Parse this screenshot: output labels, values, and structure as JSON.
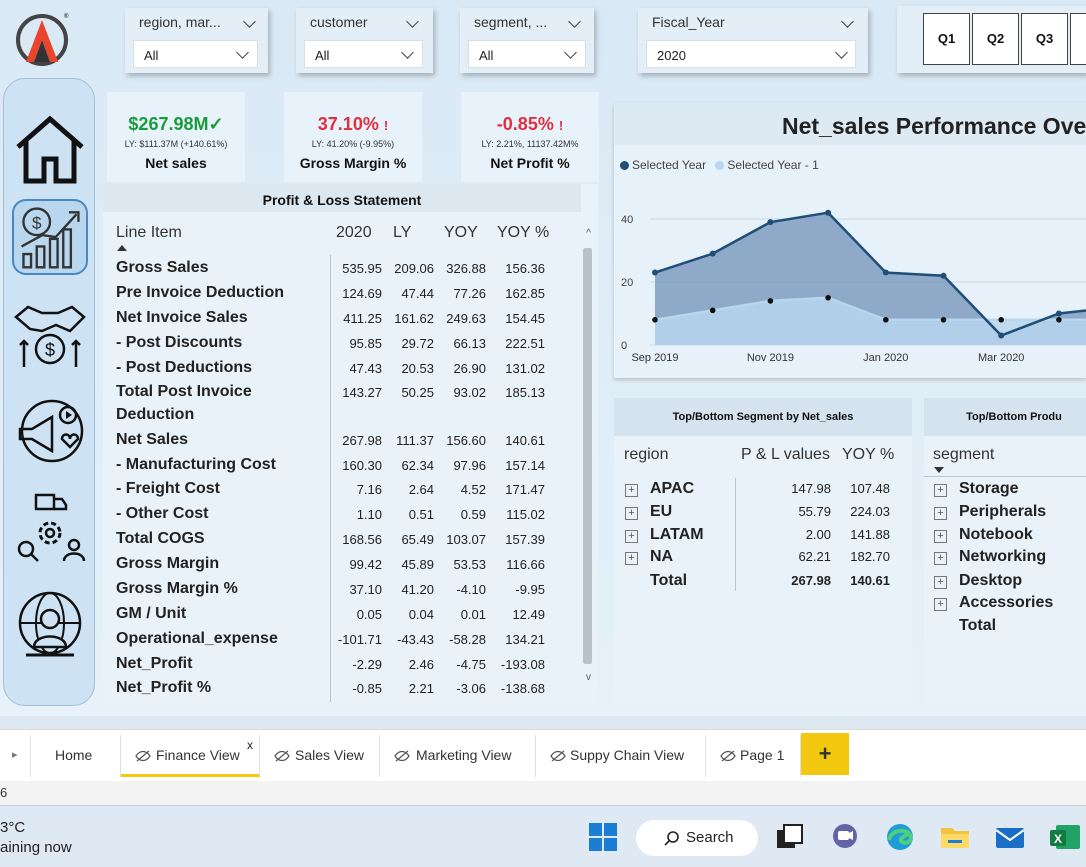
{
  "slicers": {
    "region": {
      "label": "region, mar...",
      "value": "All"
    },
    "customer": {
      "label": "customer",
      "value": "All"
    },
    "segment": {
      "label": "segment, ...",
      "value": "All"
    },
    "fiscal_year": {
      "label": "Fiscal_Year",
      "value": "2020"
    }
  },
  "quarters": [
    "Q1",
    "Q2",
    "Q3"
  ],
  "kpis": {
    "net_sales": {
      "value": "$267.98M",
      "ly": "LY: $111.37M (+140.61%)",
      "title": "Net sales",
      "color": "#1a9c3c"
    },
    "gross_margin": {
      "value": "37.10%",
      "ly": "LY: 41.20% (-9.95%)",
      "title": "Gross Margin %",
      "color": "#e03040"
    },
    "net_profit": {
      "value": "-0.85%",
      "ly": "LY: 2.21%, 11137.42M%",
      "title": "Net Profit %",
      "color": "#e03040"
    }
  },
  "pl": {
    "title": "Profit & Loss Statement",
    "headers": [
      "Line Item",
      "2020",
      "LY",
      "YOY",
      "YOY %"
    ],
    "rows": [
      {
        "label": "Gross Sales",
        "v": [
          "535.95",
          "209.06",
          "326.88",
          "156.36"
        ]
      },
      {
        "label": "Pre Invoice Deduction",
        "v": [
          "124.69",
          "47.44",
          "77.26",
          "162.85"
        ]
      },
      {
        "label": "Net Invoice Sales",
        "v": [
          "411.25",
          "161.62",
          "249.63",
          "154.45"
        ]
      },
      {
        "label": "- Post Discounts",
        "v": [
          "95.85",
          "29.72",
          "66.13",
          "222.51"
        ]
      },
      {
        "label": "- Post Deductions",
        "v": [
          "47.43",
          "20.53",
          "26.90",
          "131.02"
        ]
      },
      {
        "label": "Total Post Invoice",
        "label2": "Deduction",
        "v": [
          "143.27",
          "50.25",
          "93.02",
          "185.13"
        ]
      },
      {
        "label": "Net Sales",
        "v": [
          "267.98",
          "111.37",
          "156.60",
          "140.61"
        ]
      },
      {
        "label": "- Manufacturing Cost",
        "v": [
          "160.30",
          "62.34",
          "97.96",
          "157.14"
        ]
      },
      {
        "label": "- Freight Cost",
        "v": [
          "7.16",
          "2.64",
          "4.52",
          "171.47"
        ]
      },
      {
        "label": "- Other Cost",
        "v": [
          "1.10",
          "0.51",
          "0.59",
          "115.02"
        ]
      },
      {
        "label": "Total COGS",
        "v": [
          "168.56",
          "65.49",
          "103.07",
          "157.39"
        ]
      },
      {
        "label": "Gross Margin",
        "v": [
          "99.42",
          "45.89",
          "53.53",
          "116.66"
        ]
      },
      {
        "label": "Gross Margin %",
        "v": [
          "37.10",
          "41.20",
          "-4.10",
          "-9.95"
        ]
      },
      {
        "label": "GM / Unit",
        "v": [
          "0.05",
          "0.04",
          "0.01",
          "12.49"
        ]
      },
      {
        "label": "Operational_expense",
        "v": [
          "-101.71",
          "-43.43",
          "-58.28",
          "134.21"
        ]
      },
      {
        "label": "Net_Profit",
        "v": [
          "-2.29",
          "2.46",
          "-4.75",
          "-193.08"
        ]
      },
      {
        "label": "Net_Profit %",
        "v": [
          "-0.85",
          "2.21",
          "-3.06",
          "-138.68"
        ]
      }
    ]
  },
  "chart": {
    "title": "Net_sales Performance Ove",
    "legend": [
      "Selected Year",
      "Selected Year - 1"
    ],
    "colors": {
      "selected": "#1f4e79",
      "previous": "#b8d6ee"
    }
  },
  "chart_data": {
    "type": "area",
    "x": [
      "Sep 2019",
      "Oct 2019",
      "Nov 2019",
      "Dec 2019",
      "Jan 2020",
      "Feb 2020",
      "Mar 2020",
      "Apr 2020",
      "May 2020"
    ],
    "x_tick_labels": [
      "Sep 2019",
      "Nov 2019",
      "Jan 2020",
      "Mar 2020"
    ],
    "y_ticks": [
      "0",
      "20",
      "40"
    ],
    "ylim": [
      0,
      45
    ],
    "series": [
      {
        "name": "Selected Year",
        "values": [
          23,
          29,
          39,
          42,
          23,
          22,
          3,
          10,
          12
        ]
      },
      {
        "name": "Selected Year - 1",
        "values": [
          8,
          11,
          14,
          15,
          8,
          8,
          8,
          8,
          8
        ]
      }
    ]
  },
  "region_table": {
    "title": "Top/Bottom Segment by Net_sales",
    "headers": [
      "region",
      "P & L values",
      "YOY %"
    ],
    "rows": [
      {
        "name": "APAC",
        "pl": "147.98",
        "yoy": "107.48"
      },
      {
        "name": "EU",
        "pl": "55.79",
        "yoy": "224.03"
      },
      {
        "name": "LATAM",
        "pl": "2.00",
        "yoy": "141.88"
      },
      {
        "name": "NA",
        "pl": "62.21",
        "yoy": "182.70"
      }
    ],
    "total": {
      "name": "Total",
      "pl": "267.98",
      "yoy": "140.61"
    }
  },
  "segment_table": {
    "title": "Top/Bottom Produ",
    "header": "segment",
    "rows": [
      "Storage",
      "Peripherals",
      "Notebook",
      "Networking",
      "Desktop",
      "Accessories"
    ],
    "total": "Total"
  },
  "tabs": [
    "Home",
    "Finance View",
    "Sales View",
    "Marketing View",
    "Suppy Chain View",
    "Page 1"
  ],
  "tab_close": "x",
  "add_tab": "+",
  "status": {
    "page": "6"
  },
  "taskbar": {
    "temp": "3°C",
    "weather": "aining now",
    "search": "Search"
  }
}
